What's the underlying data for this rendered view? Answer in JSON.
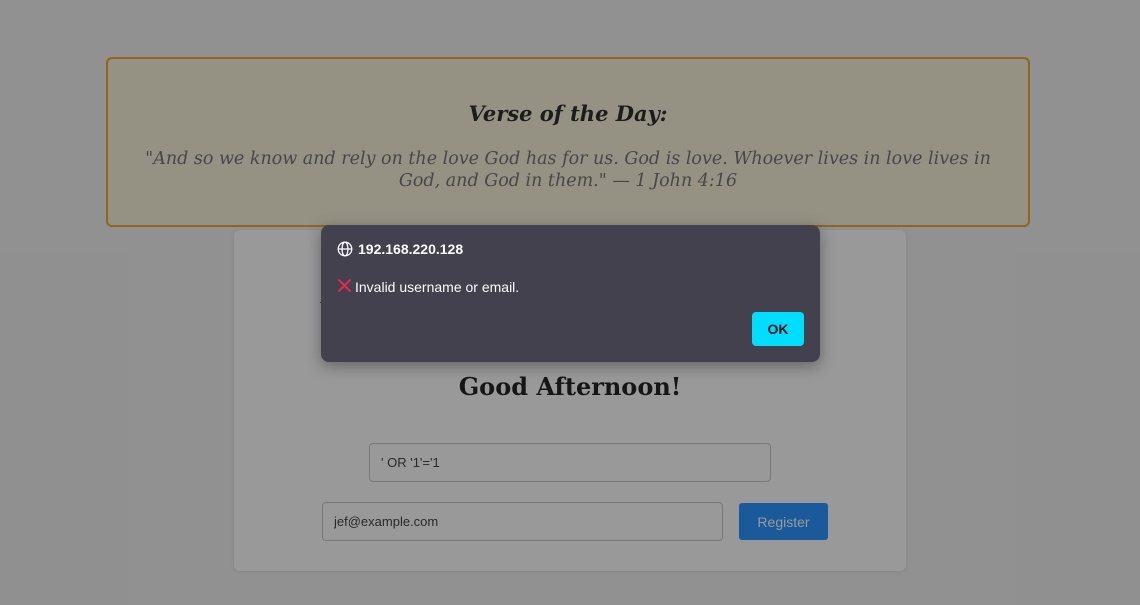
{
  "verse": {
    "title": "Verse of the Day:",
    "text": "\"And so we know and rely on the love God has for us. God is love. Whoever lives in love lives in God, and God in them.\" — 1 John 4:16"
  },
  "card": {
    "greeting": "Good Afternoon!",
    "username_value": "' OR '1'='1",
    "email_value": "jef@example.com",
    "register_label": "Register"
  },
  "dialog": {
    "origin": "192.168.220.128",
    "icon": "cross-icon",
    "message": "Invalid username or email.",
    "ok_label": "OK"
  },
  "colors": {
    "overlay": "#1c1c1e",
    "dialog_bg": "#42414d",
    "ok_button": "#00ddff",
    "register_button": "#1a8cff",
    "verse_border": "#f0a020",
    "error_icon": "#e22850"
  }
}
